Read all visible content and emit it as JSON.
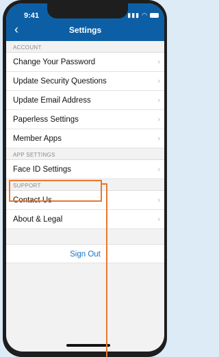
{
  "status": {
    "time": "9:41"
  },
  "header": {
    "title": "Settings",
    "back_icon": "chevron-left-icon"
  },
  "sections": {
    "account": "ACCOUNT",
    "app_settings": "APP SETTINGS",
    "support": "SUPPORT"
  },
  "account_items": [
    {
      "label": "Change Your Password"
    },
    {
      "label": "Update Security Questions"
    },
    {
      "label": "Update Email Address"
    },
    {
      "label": "Paperless Settings"
    },
    {
      "label": "Member Apps"
    }
  ],
  "app_items": [
    {
      "label": "Face ID Settings"
    }
  ],
  "support_items": [
    {
      "label": "Contact Us"
    },
    {
      "label": "About & Legal"
    }
  ],
  "sign_out_label": "Sign Out",
  "chevron": "›",
  "colors": {
    "header": "#0d5fa5",
    "accent": "#1673c4",
    "callout": "#e8772e"
  }
}
